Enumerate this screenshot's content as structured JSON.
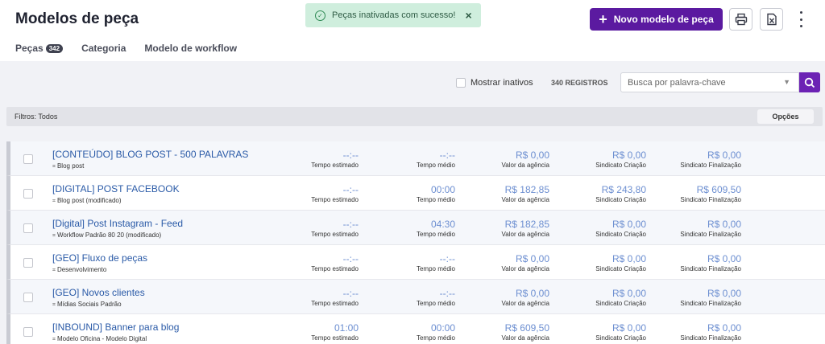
{
  "header": {
    "title": "Modelos de peça",
    "tabs": [
      {
        "label": "Peças",
        "badge": "342"
      },
      {
        "label": "Categoria"
      },
      {
        "label": "Modelo de workflow"
      }
    ],
    "new_button_label": "Novo modelo de peça",
    "icons": {
      "print": "printer-icon",
      "excel": "excel-icon",
      "more": "more-vertical-icon"
    }
  },
  "toast": {
    "text": "Peças inativadas com sucesso!",
    "close": "×"
  },
  "controls": {
    "show_inactive_label": "Mostrar inativos",
    "record_count": "340 REGISTROS",
    "search_placeholder": "Busca por palavra-chave"
  },
  "filters": {
    "label": "Filtros: Todos",
    "options_label": "Opções"
  },
  "columns": [
    "Tempo estimado",
    "Tempo médio",
    "Valor da agência",
    "Sindicato Criação",
    "Sindicato Finalização"
  ],
  "rows": [
    {
      "title": "[CONTEÚDO] BLOG POST - 500 PALAVRAS",
      "workflow": "Blog post",
      "values": [
        "--:--",
        "--:--",
        "R$ 0,00",
        "R$ 0,00",
        "R$ 0,00"
      ]
    },
    {
      "title": "[DIGITAL] POST FACEBOOK",
      "workflow": "Blog post (modificado)",
      "values": [
        "--:--",
        "00:00",
        "R$ 182,85",
        "R$ 243,80",
        "R$ 609,50"
      ]
    },
    {
      "title": "[Digital] Post Instagram - Feed",
      "workflow": "Workflow Padrão 80 20 (modificado)",
      "values": [
        "--:--",
        "04:30",
        "R$ 182,85",
        "R$ 0,00",
        "R$ 0,00"
      ]
    },
    {
      "title": "[GEO] Fluxo de peças",
      "workflow": "Desenvolvimento",
      "values": [
        "--:--",
        "--:--",
        "R$ 0,00",
        "R$ 0,00",
        "R$ 0,00"
      ]
    },
    {
      "title": "[GEO] Novos clientes",
      "workflow": "Mídias Sociais Padrão",
      "values": [
        "--:--",
        "--:--",
        "R$ 0,00",
        "R$ 0,00",
        "R$ 0,00"
      ]
    },
    {
      "title": "[INBOUND] Banner para blog",
      "workflow": "Modelo Oficina - Modelo Digital",
      "values": [
        "01:00",
        "00:00",
        "R$ 609,50",
        "R$ 0,00",
        "R$ 0,00"
      ]
    }
  ],
  "colors": {
    "accent": "#5b1aa0",
    "link": "#2a5aa7",
    "value": "#6d8fd1",
    "toast_bg": "#cfeedd"
  }
}
